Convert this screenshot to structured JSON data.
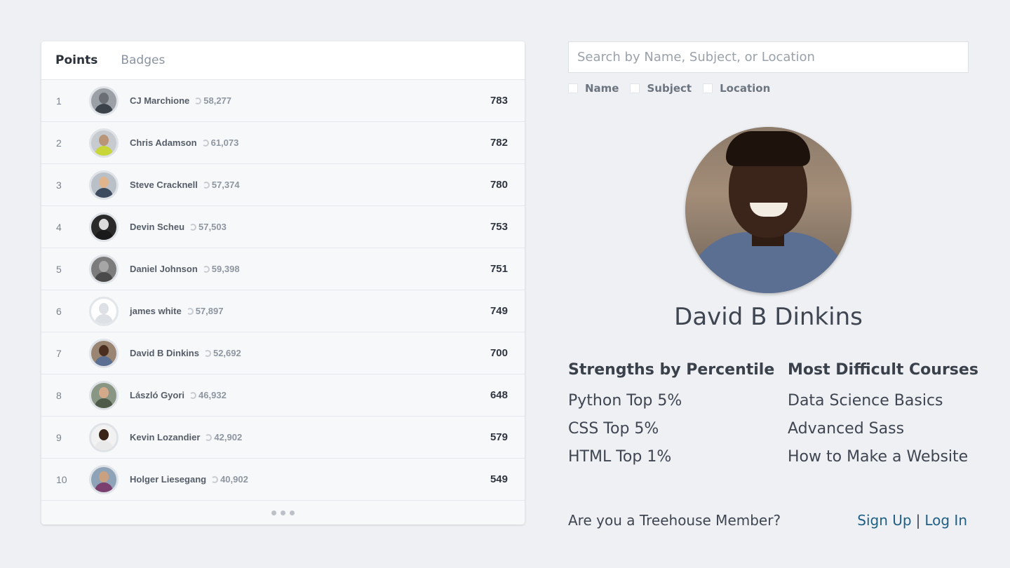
{
  "leaderboard": {
    "tabs": [
      {
        "label": "Points"
      },
      {
        "label": "Badges"
      }
    ],
    "rows": [
      {
        "rank": "1",
        "name": "CJ Marchione",
        "total": "58,277",
        "points": "783",
        "avatar": {
          "skin": "#6b6f75",
          "shirt": "#3c424a",
          "bg": "#9aa0a6"
        }
      },
      {
        "rank": "2",
        "name": "Chris Adamson",
        "total": "61,073",
        "points": "782",
        "avatar": {
          "skin": "#b89478",
          "shirt": "#c8d63a",
          "bg": "#c7cbcf"
        }
      },
      {
        "rank": "3",
        "name": "Steve Cracknell",
        "total": "57,374",
        "points": "780",
        "avatar": {
          "skin": "#e0b48d",
          "shirt": "#3e4a5e",
          "bg": "#b9c0c8"
        }
      },
      {
        "rank": "4",
        "name": "Devin Scheu",
        "total": "57,503",
        "points": "753",
        "avatar": {
          "skin": "#dcdcdc",
          "shirt": "#1a1a1a",
          "bg": "#2a2a2a"
        }
      },
      {
        "rank": "5",
        "name": "Daniel Johnson",
        "total": "59,398",
        "points": "751",
        "avatar": {
          "skin": "#a6a6a6",
          "shirt": "#4a4a4a",
          "bg": "#7c7c7c"
        }
      },
      {
        "rank": "6",
        "name": "james white",
        "total": "57,897",
        "points": "749",
        "avatar": null
      },
      {
        "rank": "7",
        "name": "David B Dinkins",
        "total": "52,692",
        "points": "700",
        "avatar": {
          "skin": "#4a2e1f",
          "shirt": "#5b6f93",
          "bg": "#9a8573"
        }
      },
      {
        "rank": "8",
        "name": "László Gyori",
        "total": "46,932",
        "points": "648",
        "avatar": {
          "skin": "#d3a98a",
          "shirt": "#4e5b4a",
          "bg": "#8a9684"
        }
      },
      {
        "rank": "9",
        "name": "Kevin Lozandier",
        "total": "42,902",
        "points": "579",
        "avatar": {
          "skin": "#3a2418",
          "shirt": "#e9e9e9",
          "bg": "#f2f2f2"
        }
      },
      {
        "rank": "10",
        "name": "Holger Liesegang",
        "total": "40,902",
        "points": "549",
        "avatar": {
          "skin": "#c9a080",
          "shirt": "#7a3f6e",
          "bg": "#8fa3b8"
        }
      }
    ]
  },
  "search": {
    "placeholder": "Search by Name, Subject, or Location",
    "filters": [
      {
        "label": "Name"
      },
      {
        "label": "Subject"
      },
      {
        "label": "Location"
      }
    ]
  },
  "profile": {
    "name": "David B Dinkins",
    "strengths_title": "Strengths by Percentile",
    "strengths": [
      "Python Top 5%",
      "CSS Top 5%",
      "HTML Top 1%"
    ],
    "courses_title": "Most Difficult Courses",
    "courses": [
      "Data Science Basics",
      "Advanced Sass",
      "How to Make a Website"
    ]
  },
  "footer": {
    "question": "Are you a Treehouse Member?",
    "signup": "Sign Up",
    "separator": "|",
    "login": "Log In"
  },
  "colors": {
    "link": "#1f5f86",
    "background": "#eef0f3"
  }
}
